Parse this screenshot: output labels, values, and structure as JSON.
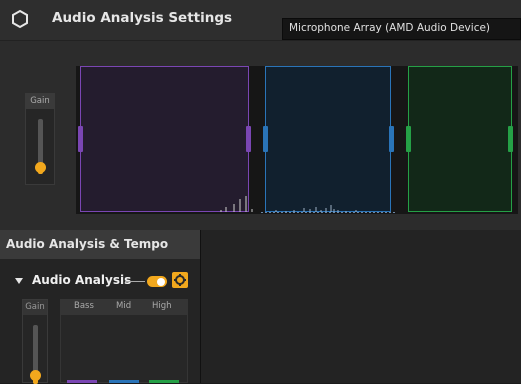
{
  "header": {
    "title": "Audio Analysis Settings",
    "icon": "hexagon-icon"
  },
  "device_select": {
    "value": "Microphone Array (AMD Audio Device)"
  },
  "input_gain": {
    "label": "Gain",
    "level": 0.12
  },
  "bands": [
    {
      "name": "bass",
      "color": "#7a46b3"
    },
    {
      "name": "mid",
      "color": "#2a74b8"
    },
    {
      "name": "high",
      "color": "#25a046"
    }
  ],
  "section": {
    "title": "Audio Analysis & Tempo"
  },
  "audio_analysis": {
    "label": "Audio Analysis",
    "enabled": true,
    "accent": "#f2a81d",
    "gain": {
      "label": "Gain",
      "level": 0.15
    },
    "band_labels": {
      "bass": "Bass",
      "mid": "Mid",
      "high": "High"
    }
  }
}
